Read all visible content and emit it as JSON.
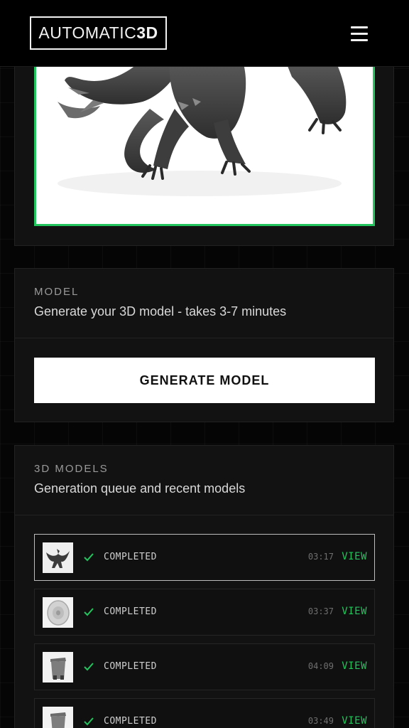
{
  "brand": {
    "logo_light": "AUTOMATIC",
    "logo_bold": "3D"
  },
  "header": {
    "menu_icon": "hamburger-menu-icon"
  },
  "preview": {
    "image": "dragon-render",
    "accent": "#22c55e"
  },
  "model_section": {
    "eyebrow": "MODEL",
    "subtitle": "Generate your 3D model - takes 3-7 minutes",
    "button_label": "GENERATE MODEL"
  },
  "models_section": {
    "eyebrow": "3D MODELS",
    "subtitle": "Generation queue and recent models",
    "items": [
      {
        "thumbnail": "dragon",
        "status": "COMPLETED",
        "time": "03:17",
        "action": "VIEW"
      },
      {
        "thumbnail": "wheel",
        "status": "COMPLETED",
        "time": "03:37",
        "action": "VIEW"
      },
      {
        "thumbnail": "trash-bin",
        "status": "COMPLETED",
        "time": "04:09",
        "action": "VIEW"
      },
      {
        "thumbnail": "trash-bin",
        "status": "COMPLETED",
        "time": "03:49",
        "action": "VIEW"
      }
    ]
  },
  "colors": {
    "accent": "#22c55e",
    "background": "#050505",
    "card": "#121212"
  }
}
